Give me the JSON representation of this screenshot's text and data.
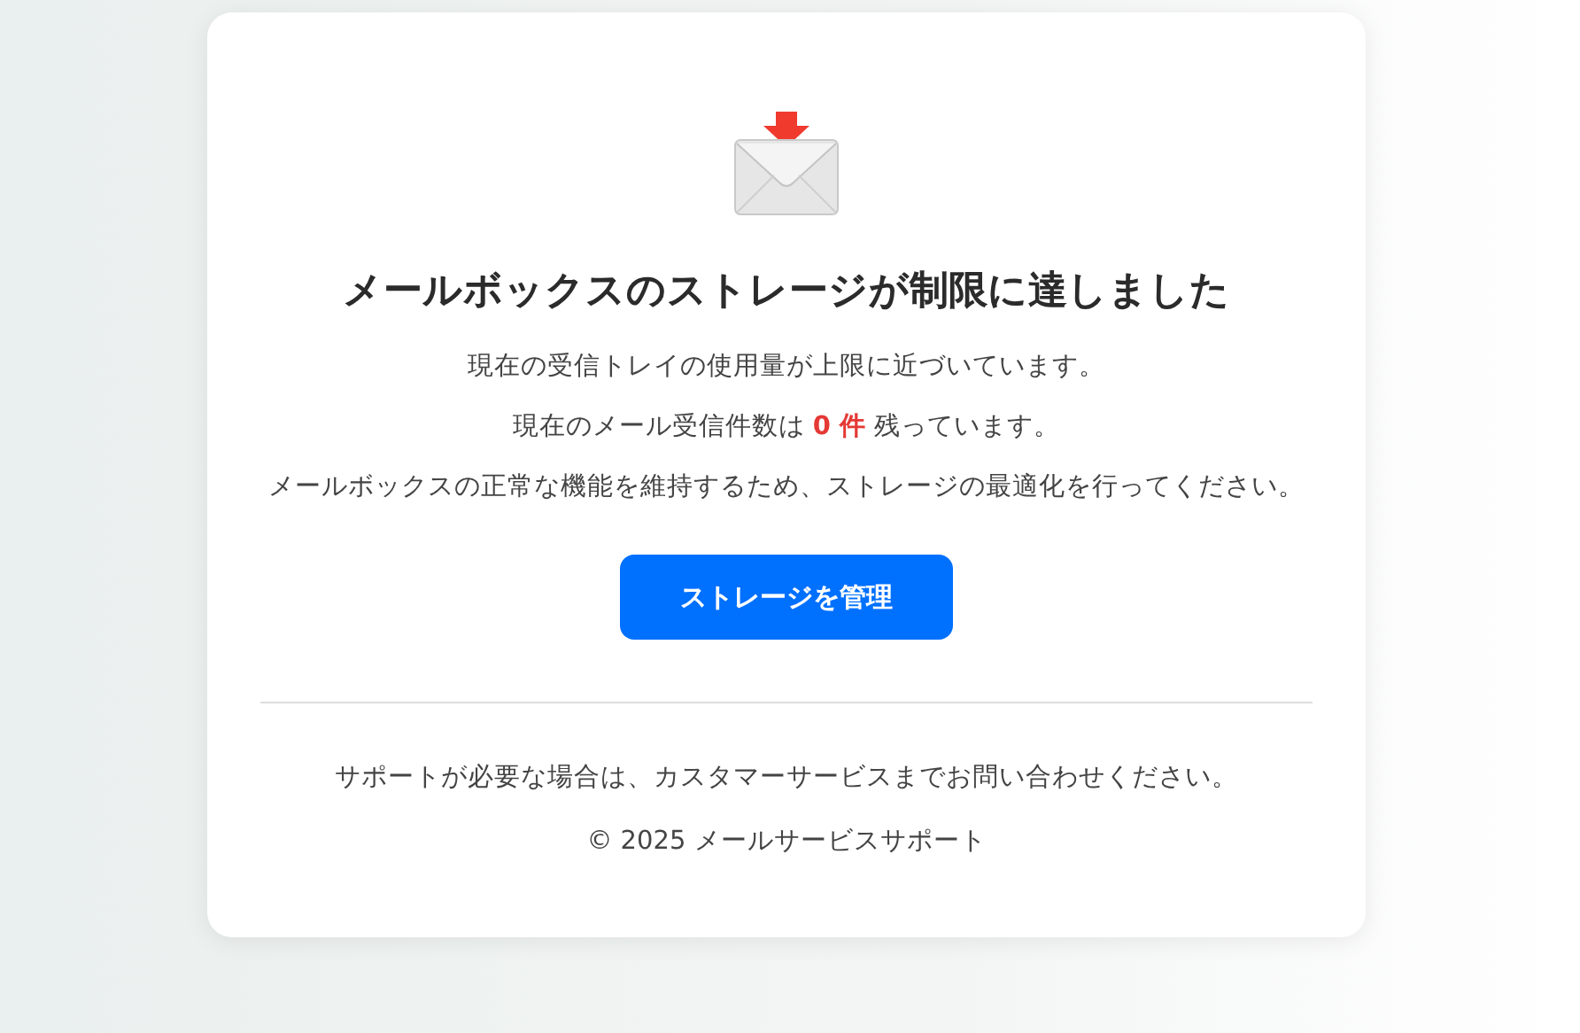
{
  "title": "メールボックスのストレージが制限に達しました",
  "messages": [
    "現在の受信トレイの使用量が上限に近づいています。",
    "現在のメール受信件数は **0 件** 残っています。",
    "メールボックスの正常な機能を維持するため、ストレージの最適化を行ってください。"
  ],
  "button": {
    "label": "ストレージを管理"
  },
  "footer": {
    "support": "サポートが必要な場合は、カスタマーサービスまでお問い合わせください。",
    "copyright": "© 2025 メールサービスサポート"
  }
}
